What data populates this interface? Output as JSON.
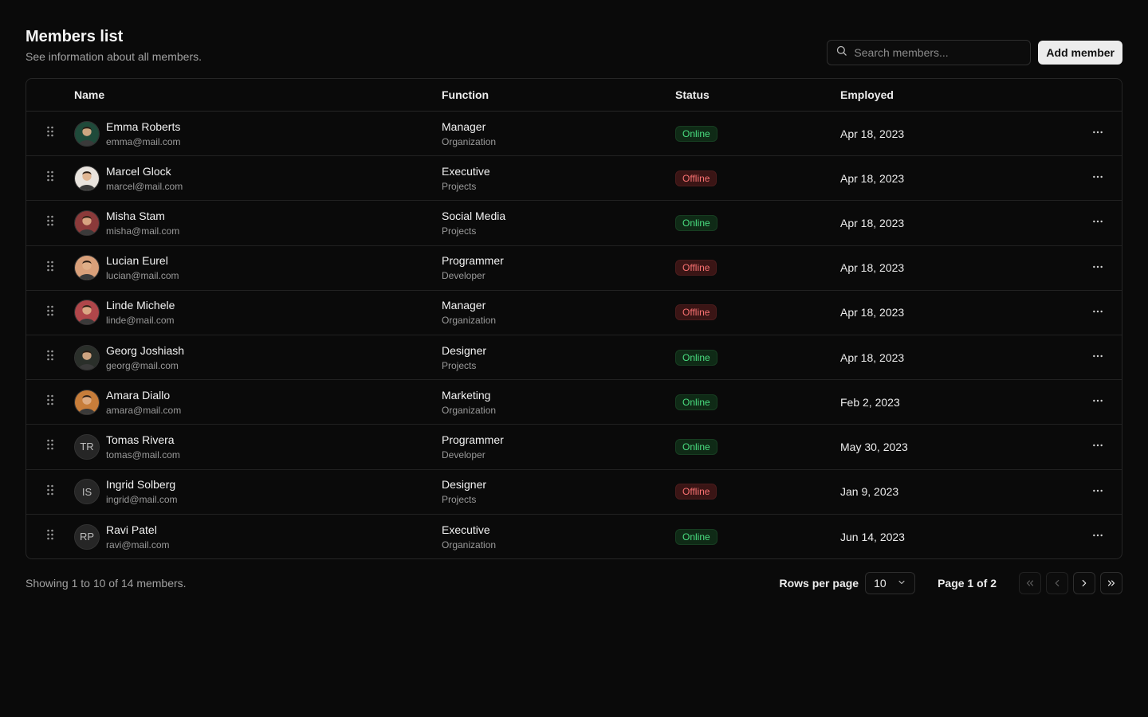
{
  "header": {
    "title": "Members list",
    "subtitle": "See information about all members.",
    "search_placeholder": "Search members...",
    "add_label": "Add member"
  },
  "columns": {
    "name": "Name",
    "function": "Function",
    "status": "Status",
    "employed": "Employed"
  },
  "members": [
    {
      "name": "Emma Roberts",
      "email": "emma@mail.com",
      "role": "Manager",
      "dept": "Organization",
      "status": "Online",
      "employed": "Apr 18, 2023",
      "avatar": "photo",
      "avatar_color": "#1f4a3a"
    },
    {
      "name": "Marcel Glock",
      "email": "marcel@mail.com",
      "role": "Executive",
      "dept": "Projects",
      "status": "Offline",
      "employed": "Apr 18, 2023",
      "avatar": "photo",
      "avatar_color": "#e9e4de"
    },
    {
      "name": "Misha Stam",
      "email": "misha@mail.com",
      "role": "Social Media",
      "dept": "Projects",
      "status": "Online",
      "employed": "Apr 18, 2023",
      "avatar": "photo",
      "avatar_color": "#8b3a3a"
    },
    {
      "name": "Lucian Eurel",
      "email": "lucian@mail.com",
      "role": "Programmer",
      "dept": "Developer",
      "status": "Offline",
      "employed": "Apr 18, 2023",
      "avatar": "photo",
      "avatar_color": "#d9a07a"
    },
    {
      "name": "Linde Michele",
      "email": "linde@mail.com",
      "role": "Manager",
      "dept": "Organization",
      "status": "Offline",
      "employed": "Apr 18, 2023",
      "avatar": "photo",
      "avatar_color": "#b0464a"
    },
    {
      "name": "Georg Joshiash",
      "email": "georg@mail.com",
      "role": "Designer",
      "dept": "Projects",
      "status": "Online",
      "employed": "Apr 18, 2023",
      "avatar": "photo",
      "avatar_color": "#2a2f2a"
    },
    {
      "name": "Amara Diallo",
      "email": "amara@mail.com",
      "role": "Marketing",
      "dept": "Organization",
      "status": "Online",
      "employed": "Feb 2, 2023",
      "avatar": "photo",
      "avatar_color": "#c77d3a"
    },
    {
      "name": "Tomas Rivera",
      "email": "tomas@mail.com",
      "role": "Programmer",
      "dept": "Developer",
      "status": "Online",
      "employed": "May 30, 2023",
      "avatar": "TR"
    },
    {
      "name": "Ingrid Solberg",
      "email": "ingrid@mail.com",
      "role": "Designer",
      "dept": "Projects",
      "status": "Offline",
      "employed": "Jan 9, 2023",
      "avatar": "IS"
    },
    {
      "name": "Ravi Patel",
      "email": "ravi@mail.com",
      "role": "Executive",
      "dept": "Organization",
      "status": "Online",
      "employed": "Jun 14, 2023",
      "avatar": "RP"
    }
  ],
  "footer": {
    "info": "Showing 1 to 10 of 14 members.",
    "rows_label": "Rows per page",
    "rows_value": "10",
    "page_label": "Page 1 of 2"
  },
  "icons": {
    "search": "search-icon",
    "drag": "grip-vertical-icon",
    "menu": "more-horizontal-icon",
    "chevron": "chevron-down-icon",
    "first": "chevrons-left-icon",
    "prev": "chevron-left-icon",
    "next": "chevron-right-icon",
    "last": "chevrons-right-icon"
  }
}
